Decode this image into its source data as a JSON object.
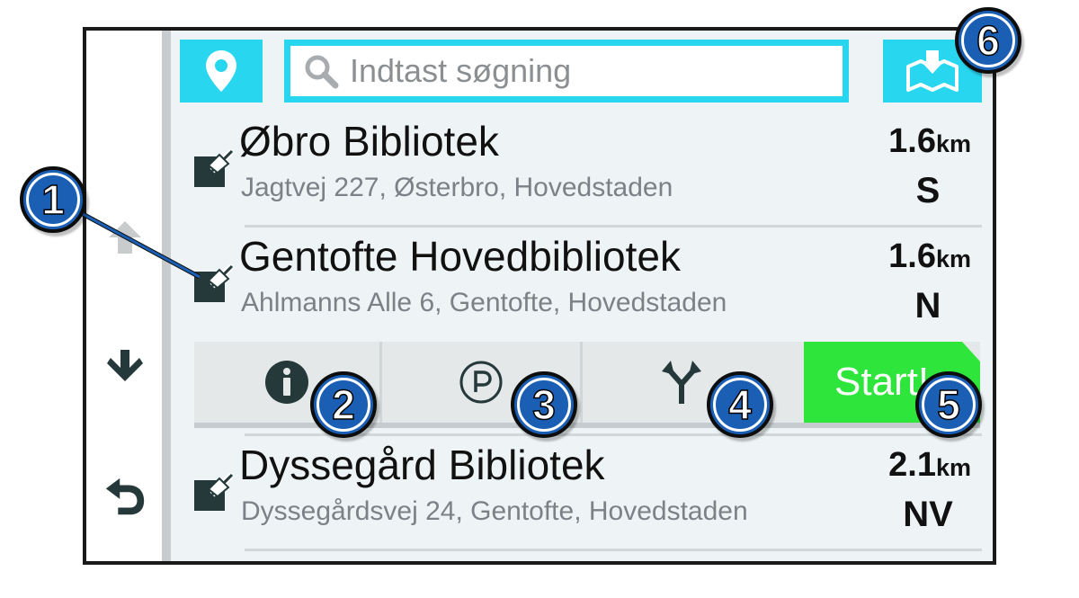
{
  "colors": {
    "accent": "#29d6f0",
    "start_green": "#2ee63b",
    "callout_blue": "#1a5fb4",
    "content_bg": "#eef4f5",
    "secondary_text": "#7a8288"
  },
  "icons": {
    "location": "location-pin-icon",
    "search": "magnifier-icon",
    "map": "map-download-icon",
    "poi": "place-pin-icon",
    "info": "info-icon",
    "parking": "parking-icon",
    "route": "route-fork-icon",
    "scroll_up": "arrow-up-icon",
    "scroll_down": "arrow-down-icon",
    "back": "back-arrow-icon"
  },
  "search": {
    "placeholder": "Indtast søgning"
  },
  "results": [
    {
      "name": "Øbro Bibliotek",
      "address": "Jagtvej 227, Østerbro, Hovedstaden",
      "distance": "1.6",
      "unit": "km",
      "direction": "S"
    },
    {
      "name": "Gentofte Hovedbibliotek",
      "address": "Ahlmanns Alle 6, Gentofte, Hovedstaden",
      "distance": "1.6",
      "unit": "km",
      "direction": "N"
    },
    {
      "name": "Dyssegård Bibliotek",
      "address": "Dyssegårdsvej 24, Gentofte, Hovedstaden",
      "distance": "2.1",
      "unit": "km",
      "direction": "NV"
    }
  ],
  "actions": {
    "start_label": "Start!"
  },
  "callouts": [
    "1",
    "2",
    "3",
    "4",
    "5",
    "6"
  ]
}
